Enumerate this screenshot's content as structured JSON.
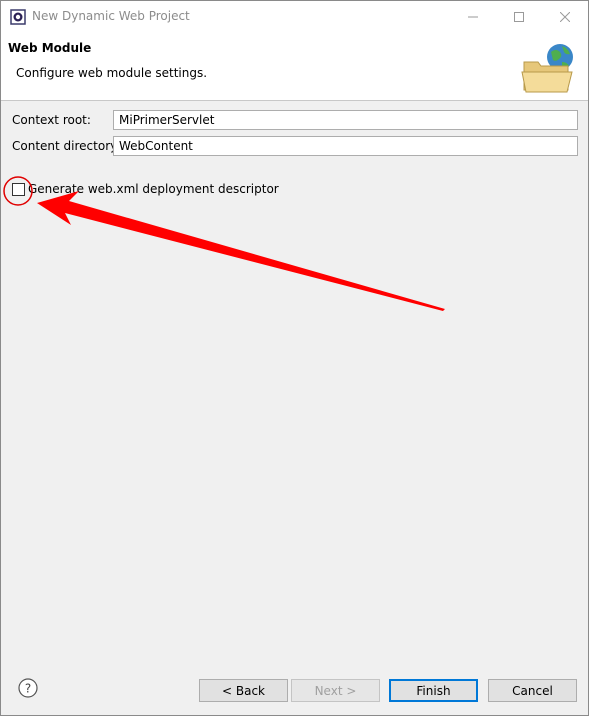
{
  "window": {
    "title": "New Dynamic Web Project"
  },
  "banner": {
    "title": "Web Module",
    "description": "Configure web module settings.",
    "icon": "web-folder-globe-icon"
  },
  "form": {
    "context_root_label": "Context root:",
    "context_root_value": "MiPrimerServlet",
    "content_dir_label": "Content directory:",
    "content_dir_value": "WebContent",
    "generate_xml_label": "Generate web.xml deployment descriptor",
    "generate_xml_checked": false
  },
  "annotation": {
    "color": "#ff0000"
  },
  "footer": {
    "help_icon": "question-mark-icon",
    "back_label": "< Back",
    "next_label": "Next >",
    "finish_label": "Finish",
    "cancel_label": "Cancel"
  }
}
